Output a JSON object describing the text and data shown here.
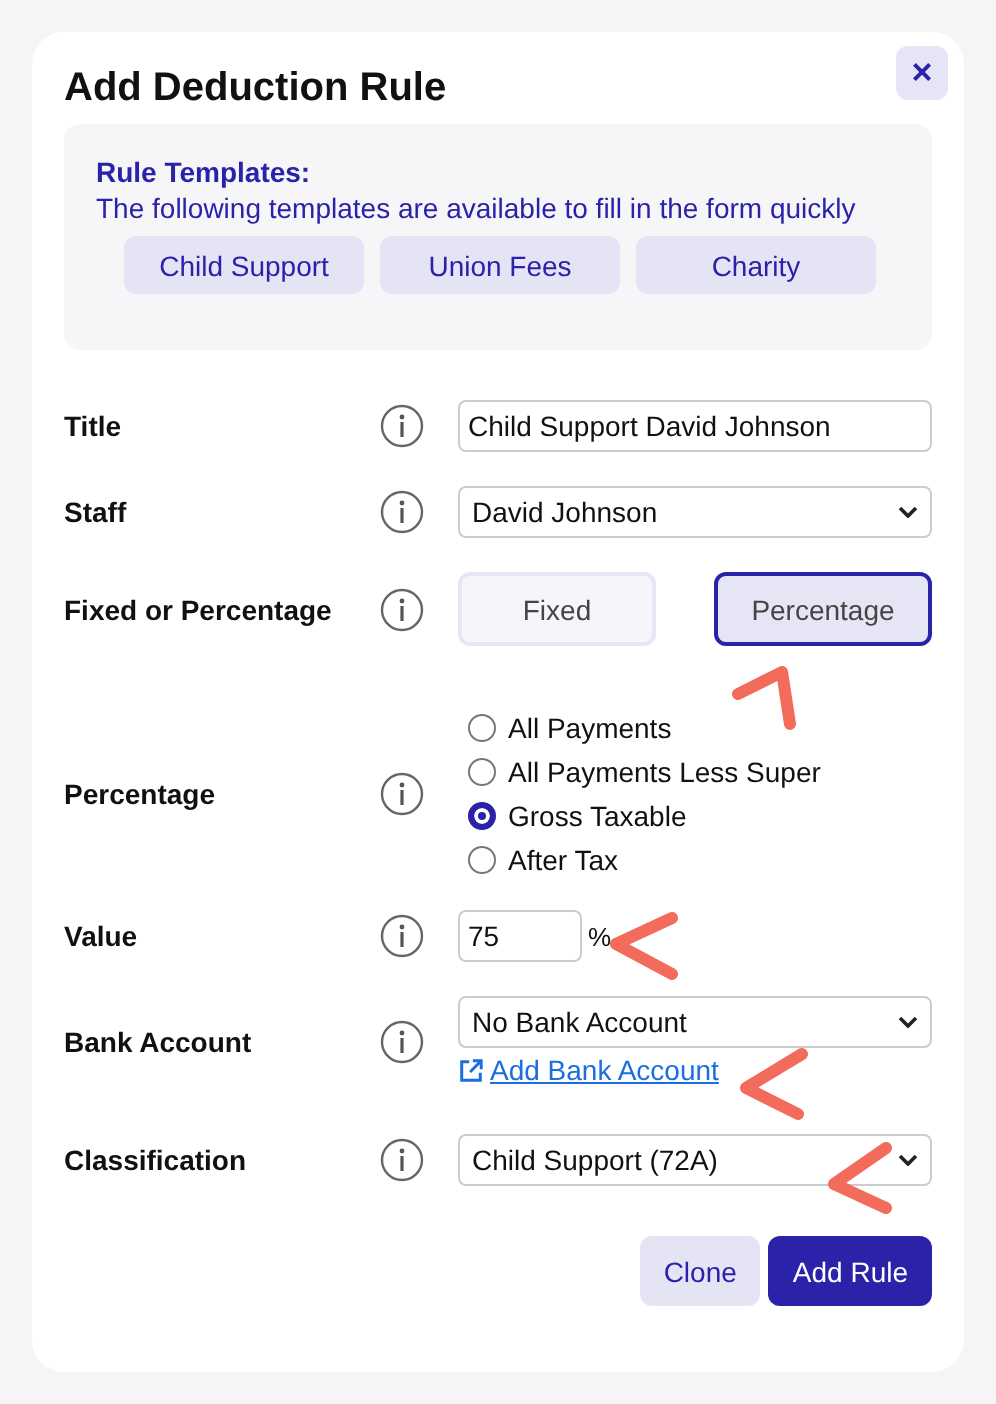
{
  "dialog": {
    "title": "Add Deduction Rule",
    "close": "×"
  },
  "templates": {
    "heading": "Rule Templates:",
    "description": "The following templates are available to fill in the form quickly",
    "buttons": [
      "Child Support",
      "Union Fees",
      "Charity"
    ]
  },
  "fields": [
    {
      "kind": "text",
      "label": "Title",
      "value": "Child Support David Johnson"
    },
    {
      "kind": "select",
      "label": "Staff",
      "value": "David Johnson"
    },
    {
      "kind": "toggle",
      "label": "Fixed or Percentage",
      "options": [
        {
          "label": "Fixed",
          "selected": false
        },
        {
          "label": "Percentage",
          "selected": true
        }
      ]
    },
    {
      "kind": "radio",
      "label": "Percentage",
      "options": [
        {
          "label": "All Payments",
          "selected": false
        },
        {
          "label": "All Payments Less Super",
          "selected": false
        },
        {
          "label": "Gross Taxable",
          "selected": true
        },
        {
          "label": "After Tax",
          "selected": false
        }
      ]
    },
    {
      "kind": "number",
      "label": "Value",
      "value": "75",
      "unit": "%"
    },
    {
      "kind": "select",
      "label": "Bank Account",
      "value": "No Bank Account",
      "link": "Add Bank Account"
    },
    {
      "kind": "select",
      "label": "Classification",
      "value": "Child Support (72A)"
    }
  ],
  "actions": [
    {
      "label": "Clone",
      "kind": "secondary"
    },
    {
      "label": "Add Rule",
      "kind": "primary"
    }
  ]
}
